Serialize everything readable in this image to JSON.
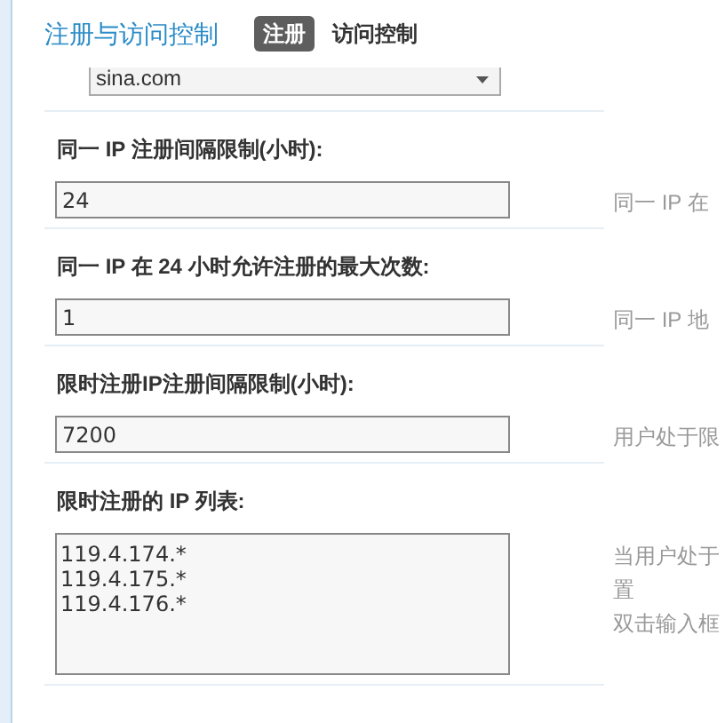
{
  "header": {
    "title": "注册与访问控制"
  },
  "tabs": [
    {
      "label": "注册",
      "selected": true
    },
    {
      "label": "访问控制",
      "selected": false
    }
  ],
  "dropdown": {
    "value": "sina.com"
  },
  "settings": [
    {
      "kind": "input",
      "label": "同一 IP 注册间隔限制(小时):",
      "value": "24",
      "hint": [
        "同一 IP 在"
      ]
    },
    {
      "kind": "input",
      "label": "同一 IP 在 24 小时允许注册的最大次数:",
      "value": "1",
      "hint": [
        "同一 IP 地"
      ]
    },
    {
      "kind": "input",
      "label": "限时注册IP注册间隔限制(小时):",
      "value": "7200",
      "hint": [
        "用户处于限"
      ]
    },
    {
      "kind": "textarea",
      "label": "限时注册的 IP 列表:",
      "value": "119.4.174.*\n119.4.175.*\n119.4.176.*",
      "hint": [
        "当用户处于",
        "置",
        "双击输入框"
      ]
    }
  ]
}
